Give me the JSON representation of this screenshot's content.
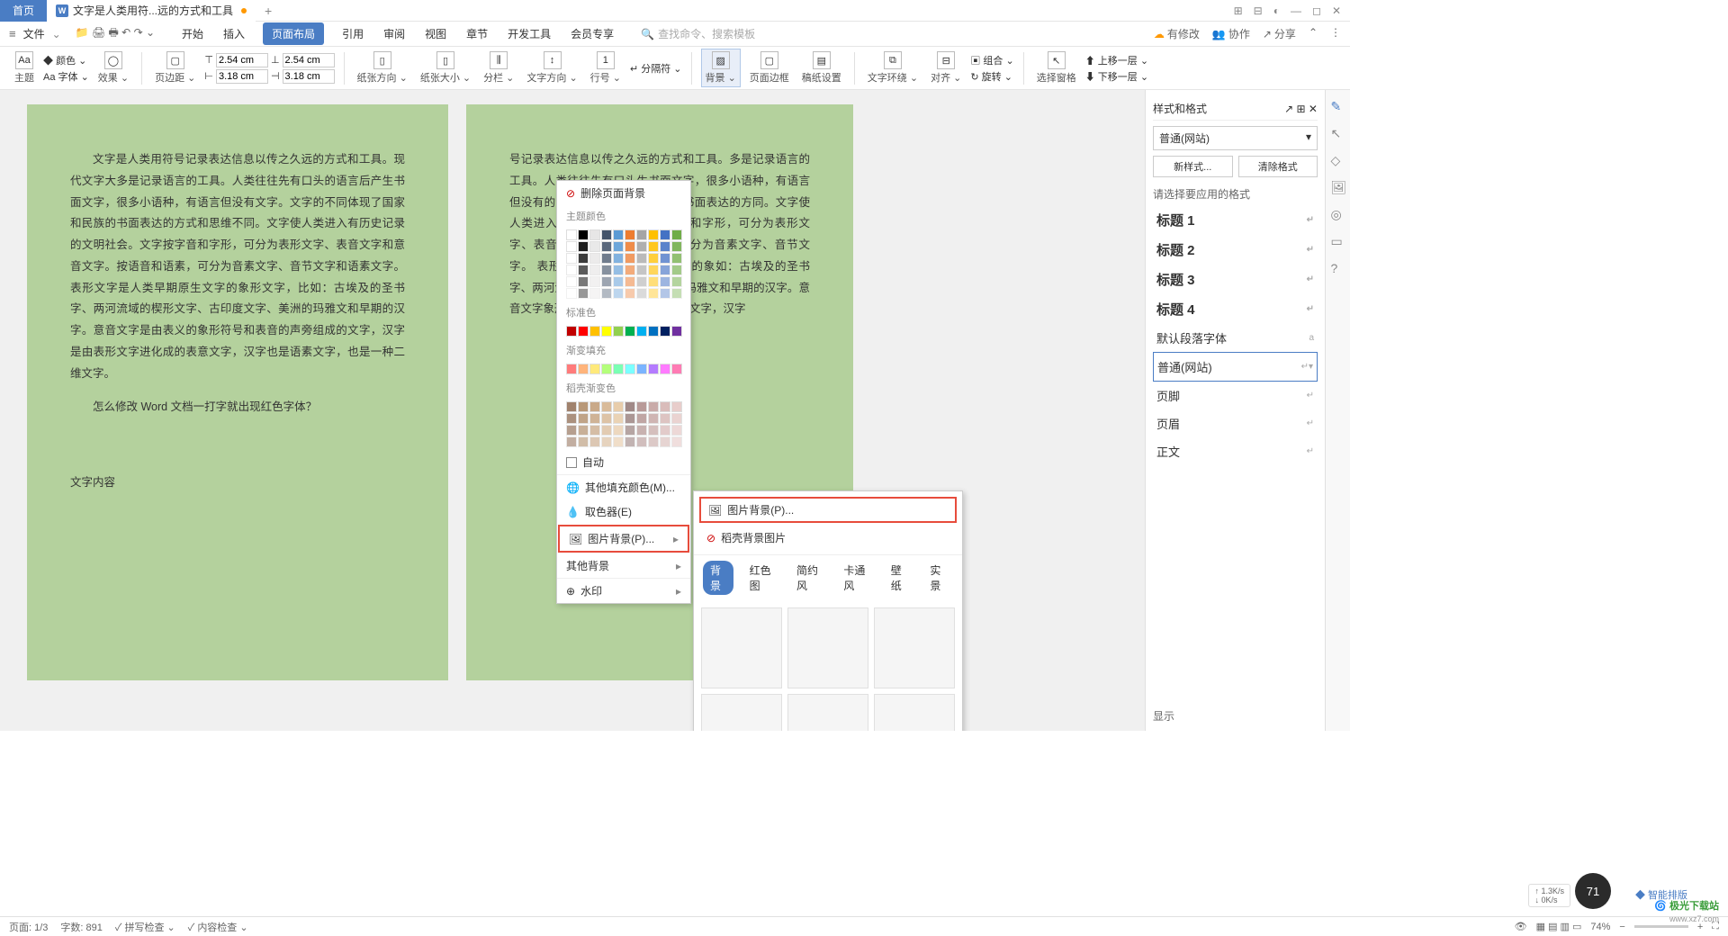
{
  "titlebar": {
    "home": "首页",
    "doc_title": "文字是人类用符...远的方式和工具",
    "add": "+"
  },
  "window_controls": {
    "layout": "⊞",
    "grid": "⊟",
    "avatar": "◐",
    "min": "—",
    "max": "◻",
    "close": "✕"
  },
  "menubar": {
    "file": "文件",
    "icons": [
      "≡",
      "📁",
      "🖨",
      "🖶",
      "↶",
      "↷"
    ],
    "tabs": [
      "开始",
      "插入",
      "页面布局",
      "引用",
      "审阅",
      "视图",
      "章节",
      "开发工具",
      "会员专享"
    ],
    "active": "页面布局",
    "search_placeholder": "查找命令、搜索模板"
  },
  "menu_right": {
    "changes": "有修改",
    "collab": "协作",
    "share": "分享"
  },
  "ribbon": {
    "theme": "主题",
    "color": "颜色",
    "font": "字体",
    "effect": "效果",
    "margin": "页边距",
    "top": "2.54 cm",
    "bottom": "2.54 cm",
    "left": "3.18 cm",
    "right": "3.18 cm",
    "orient": "纸张方向",
    "size": "纸张大小",
    "columns": "分栏",
    "textdir": "文字方向",
    "linenum": "行号",
    "sep": "分隔符",
    "bg": "背景",
    "border": "页面边框",
    "paper": "稿纸设置",
    "wrap": "文字环绕",
    "align": "对齐",
    "rotate": "旋转",
    "combine": "组合",
    "selpane": "选择窗格",
    "forward": "上移一层",
    "backward": "下移一层"
  },
  "bg_dropdown": {
    "delete": "删除页面背景",
    "theme_colors": "主题颜色",
    "standard": "标准色",
    "gradient": "渐变填充",
    "docer_gradient": "稻壳渐变色",
    "auto": "自动",
    "more_fill": "其他填充颜色(M)...",
    "eyedrop": "取色器(E)",
    "pic_bg": "图片背景(P)...",
    "other_bg": "其他背景",
    "watermark": "水印"
  },
  "submenu": {
    "pic_bg": "图片背景(P)...",
    "docer_pic": "稻壳背景图片",
    "tabs": [
      "背景",
      "红色图",
      "简约风",
      "卡通风",
      "壁纸",
      "实景"
    ]
  },
  "page1": {
    "p1": "文字是人类用符号记录表达信息以传之久远的方式和工具。现代文字大多是记录语言的工具。人类往往先有口头的语言后产生书面文字，很多小语种，有语言但没有文字。文字的不同体现了国家和民族的书面表达的方式和思维不同。文字使人类进入有历史记录的文明社会。文字按字音和字形，可分为表形文字、表音文字和意音文字。按语音和语素，可分为音素文字、音节文字和语素文字。 表形文字是人类早期原生文字的象形文字，比如：古埃及的圣书字、两河流域的楔形文字、古印度文字、美洲的玛雅文和早期的汉字。意音文字是由表义的象形符号和表音的声旁组成的文字，汉字是由表形文字进化成的表意文字，汉字也是语素文字，也是一种二维文字。",
    "p2": "怎么修改 Word 文档一打字就出现红色字体？",
    "p3": "文字内容"
  },
  "page2": {
    "p1": "号记录表达信息以传之久远的方式和工具。多是记录语言的工具。人类往往先有口头生书面文字，很多小语种，有语言但没有的不同体现了国家和民族的书面表达的方同。文字使人类进入有历史记录的文明社字音和字形，可分为表形文字、表音文字。按语音和语素，可分为音素文字、音节文字。 表形文字是人类早期原生文字的象如：古埃及的圣书字、两河流域的楔形文字、、美洲的玛雅文和早期的汉字。意音文字象形符号和表音的声旁组成的文字，汉字"
  },
  "sidebar": {
    "title": "样式和格式",
    "current": "普通(网站)",
    "new_style": "新样式...",
    "clear": "清除格式",
    "prompt": "请选择要应用的格式",
    "h1": "标题 1",
    "h2": "标题 2",
    "h3": "标题 3",
    "h4": "标题 4",
    "default_font": "默认段落字体",
    "normal_web": "普通(网站)",
    "footer": "页脚",
    "header": "页眉",
    "body": "正文",
    "show": "显示"
  },
  "statusbar": {
    "page": "页面: 1/3",
    "words": "字数: 891",
    "spell": "拼写检查",
    "content": "内容检查",
    "zoom": "74%"
  },
  "perf": {
    "up": "1.3K/s",
    "down": "0K/s",
    "pct": "71"
  },
  "watermark": {
    "name": "极光下载站",
    "url": "www.xz7.com"
  },
  "smart": "智能排版",
  "colors": {
    "theme": [
      "#ffffff",
      "#000000",
      "#e7e6e6",
      "#44546a",
      "#5b9bd5",
      "#ed7d31",
      "#a5a5a5",
      "#ffc000",
      "#4472c4",
      "#70ad47"
    ],
    "standard": [
      "#c00000",
      "#ff0000",
      "#ffc000",
      "#ffff00",
      "#92d050",
      "#00b050",
      "#00b0f0",
      "#0070c0",
      "#002060",
      "#7030a0"
    ],
    "gradient": [
      "#ff7b7b",
      "#ffb47b",
      "#ffe97b",
      "#b4ff7b",
      "#7bffb4",
      "#7bffff",
      "#7bb4ff",
      "#b47bff",
      "#ff7bff",
      "#ff7bb4"
    ],
    "docer": [
      "#a0826d",
      "#b89878",
      "#c9a989",
      "#d9bb9a",
      "#e8cdab",
      "#a08987",
      "#b89a98",
      "#c9aba9",
      "#d9bcba",
      "#e8cdcb"
    ]
  }
}
